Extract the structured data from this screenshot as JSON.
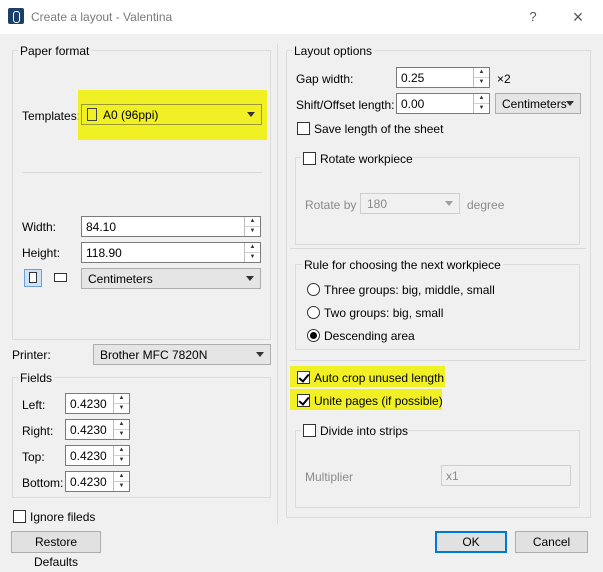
{
  "window": {
    "title": "Create a layout - Valentina",
    "help_label": "?",
    "close_label": "×"
  },
  "paper_format": {
    "group_title": "Paper format",
    "templates_label": "Templates:",
    "template_value": "A0 (96ppi)",
    "width_label": "Width:",
    "width_value": "84.10",
    "height_label": "Height:",
    "height_value": "118.90",
    "unit_value": "Centimeters"
  },
  "printer": {
    "label": "Printer:",
    "value": "Brother MFC 7820N"
  },
  "fields": {
    "group_title": "Fields",
    "left_label": "Left:",
    "left_value": "0.4230",
    "right_label": "Right:",
    "right_value": "0.4230",
    "top_label": "Top:",
    "top_value": "0.4230",
    "bottom_label": "Bottom:",
    "bottom_value": "0.4230"
  },
  "ignore_fileds": {
    "label": "Ignore fileds",
    "checked": false
  },
  "restore_defaults_label": "Restore Defaults",
  "layout_options": {
    "group_title": "Layout options",
    "gap_width_label": "Gap width:",
    "gap_width_value": "0.25",
    "gap_multiplier": "×2",
    "shift_label": "Shift/Offset length:",
    "shift_value": "0.00",
    "shift_unit": "Centimeters",
    "save_length_label": "Save length of the sheet",
    "rotate_workpiece_label": "Rotate workpiece",
    "rotate_by_label": "Rotate by",
    "rotate_by_value": "180",
    "rotate_by_unit": "degree",
    "rule_title": "Rule for choosing the next workpiece",
    "rule_options": [
      "Three groups: big, middle, small",
      "Two groups: big, small",
      "Descending area"
    ],
    "rule_selected": "Descending area",
    "auto_crop_label": "Auto crop unused length",
    "unite_pages_label": "Unite pages (if possible)",
    "divide_strips_label": "Divide into strips",
    "multiplier_label": "Multiplier",
    "multiplier_value": "x1"
  },
  "ok_label": "OK",
  "cancel_label": "Cancel",
  "colors": {
    "highlight": "#f0f000",
    "primary_button_border": "#0078d7"
  }
}
